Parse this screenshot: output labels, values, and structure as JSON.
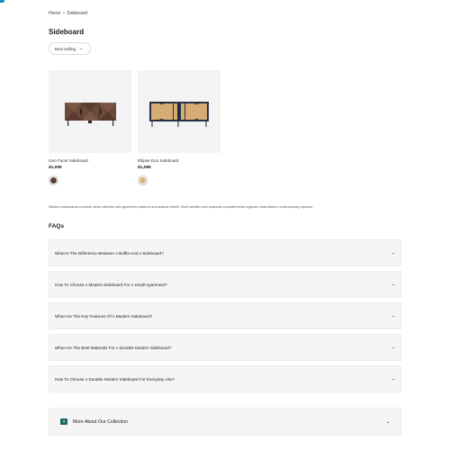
{
  "breadcrumb": {
    "home": "Home",
    "separator": ">",
    "current": "Sideboard"
  },
  "page_title": "Sideboard",
  "sort": {
    "selected": "Best selling"
  },
  "products": [
    {
      "name": "Geo Facet Sideboard",
      "price": "$1,095",
      "swatch_color": "#5a3f32"
    },
    {
      "name": "Ellipse Duo Sideboard",
      "price": "$1,085",
      "swatch_color": "#d8b27a"
    }
  ],
  "collection_description": "Modern sideboards combine sleek cabinets with geometric patterns and walnut veneer. Bold handles and spacious compartments organize essentials in contemporary spaces.",
  "faq": {
    "heading": "FAQs",
    "items": [
      "What Is The Difference Between A Buffet And A Sideboard?",
      "How To Choose A Modern Sideboard For A Small Apartment?",
      "What Are The Key Features Of A Modern Sideboard?",
      "What Are The Best Materials For A Durable Modern Sideboard?",
      "How To Choose A Durable Modern Sideboard For Everyday Use?"
    ]
  },
  "more_section": {
    "label": "More About Our Collection",
    "icon": "chat-icon"
  },
  "colors": {
    "accent": "#17675e",
    "logo": "#1a8fb0"
  }
}
